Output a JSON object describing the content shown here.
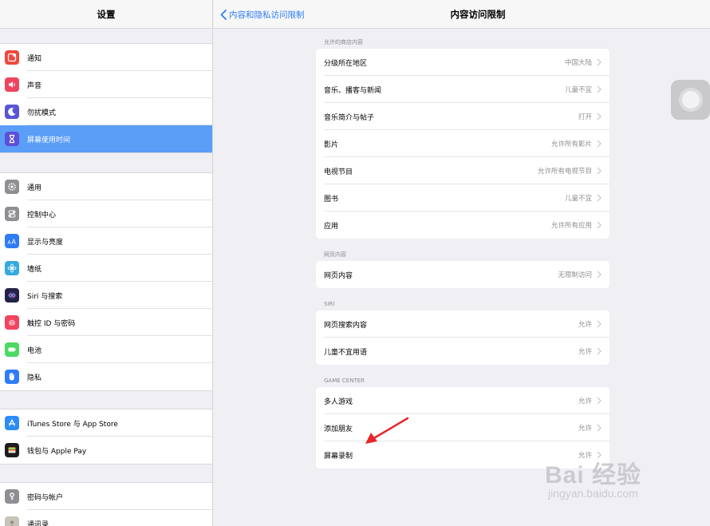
{
  "sidebar": {
    "title": "设置",
    "groups": [
      [
        {
          "label": "通知",
          "icon": "notification-icon",
          "color": "#f0473d"
        },
        {
          "label": "声音",
          "icon": "sound-icon",
          "color": "#f0445f"
        },
        {
          "label": "勿扰模式",
          "icon": "moon-icon",
          "color": "#5856d6"
        },
        {
          "label": "屏幕使用时间",
          "icon": "hourglass-icon",
          "color": "#5d4fd6",
          "selected": true
        }
      ],
      [
        {
          "label": "通用",
          "icon": "gear-icon",
          "color": "#8e8e93"
        },
        {
          "label": "控制中心",
          "icon": "toggles-icon",
          "color": "#8e8e93"
        },
        {
          "label": "显示与亮度",
          "icon": "text-size-icon",
          "color": "#2f7cf6"
        },
        {
          "label": "墙纸",
          "icon": "flower-icon",
          "color": "#35aadc"
        },
        {
          "label": "Siri 与搜索",
          "icon": "siri-icon",
          "color": "#222244"
        },
        {
          "label": "触控 ID 与密码",
          "icon": "fingerprint-icon",
          "color": "#f0445f"
        },
        {
          "label": "电池",
          "icon": "battery-icon",
          "color": "#4cd964"
        },
        {
          "label": "隐私",
          "icon": "hand-icon",
          "color": "#2f7cf6"
        }
      ],
      [
        {
          "label": "iTunes Store 与 App Store",
          "icon": "app-store-icon",
          "color": "#2f8cf6"
        },
        {
          "label": "钱包与 Apple Pay",
          "icon": "wallet-icon",
          "color": "#1c1c1e"
        }
      ],
      [
        {
          "label": "密码与帐户",
          "icon": "key-icon",
          "color": "#8e8e93"
        },
        {
          "label": "通讯录",
          "icon": "contacts-icon",
          "color": "#c8c3b8"
        }
      ]
    ]
  },
  "header": {
    "back_label": "内容和隐私访问限制",
    "title": "内容访问限制"
  },
  "sections": [
    {
      "title": "允许的商店内容",
      "rows": [
        {
          "label": "分级所在地区",
          "value": "中国大陆"
        },
        {
          "label": "音乐、播客与新闻",
          "value": "儿童不宜"
        },
        {
          "label": "音乐简介与帖子",
          "value": "打开"
        },
        {
          "label": "影片",
          "value": "允许所有影片"
        },
        {
          "label": "电视节目",
          "value": "允许所有电视节目"
        },
        {
          "label": "图书",
          "value": "儿童不宜"
        },
        {
          "label": "应用",
          "value": "允许所有应用"
        }
      ]
    },
    {
      "title": "网页内容",
      "rows": [
        {
          "label": "网页内容",
          "value": "无限制访问"
        }
      ]
    },
    {
      "title": "SIRI",
      "rows": [
        {
          "label": "网页搜索内容",
          "value": "允许"
        },
        {
          "label": "儿童不宜用语",
          "value": "允许"
        }
      ]
    },
    {
      "title": "GAME CENTER",
      "rows": [
        {
          "label": "多人游戏",
          "value": "允许"
        },
        {
          "label": "添加朋友",
          "value": "允许"
        },
        {
          "label": "屏幕录制",
          "value": "允许"
        }
      ]
    }
  ],
  "watermark": {
    "brand": "Bai 经验",
    "url": "jingyan.baidu.com"
  },
  "colors": {
    "accent": "#2f7cf6",
    "selected": "#5a9ef8",
    "annotation_arrow": "#e8262a"
  }
}
